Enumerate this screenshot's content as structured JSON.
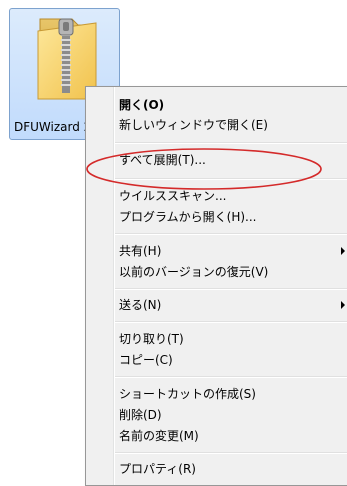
{
  "file": {
    "name": "DFUWizard 2"
  },
  "menu": {
    "items": [
      {
        "label": "開く(O)"
      },
      {
        "label": "新しいウィンドウで開く(E)"
      },
      {
        "label": "すべて展開(T)..."
      },
      {
        "label": "ウイルススキャン..."
      },
      {
        "label": "プログラムから開く(H)..."
      },
      {
        "label": "共有(H)"
      },
      {
        "label": "以前のバージョンの復元(V)"
      },
      {
        "label": "送る(N)"
      },
      {
        "label": "切り取り(T)"
      },
      {
        "label": "コピー(C)"
      },
      {
        "label": "ショートカットの作成(S)"
      },
      {
        "label": "削除(D)"
      },
      {
        "label": "名前の変更(M)"
      },
      {
        "label": "プロパティ(R)"
      }
    ]
  },
  "colors": {
    "selection_fill": "#c1dbfc",
    "selection_border": "#7da2ce",
    "menu_background": "#f0f0f0",
    "annotation": "#d42a2a"
  },
  "icons": {
    "file": "zip-folder-icon",
    "submenu": "submenu-arrow-icon"
  }
}
